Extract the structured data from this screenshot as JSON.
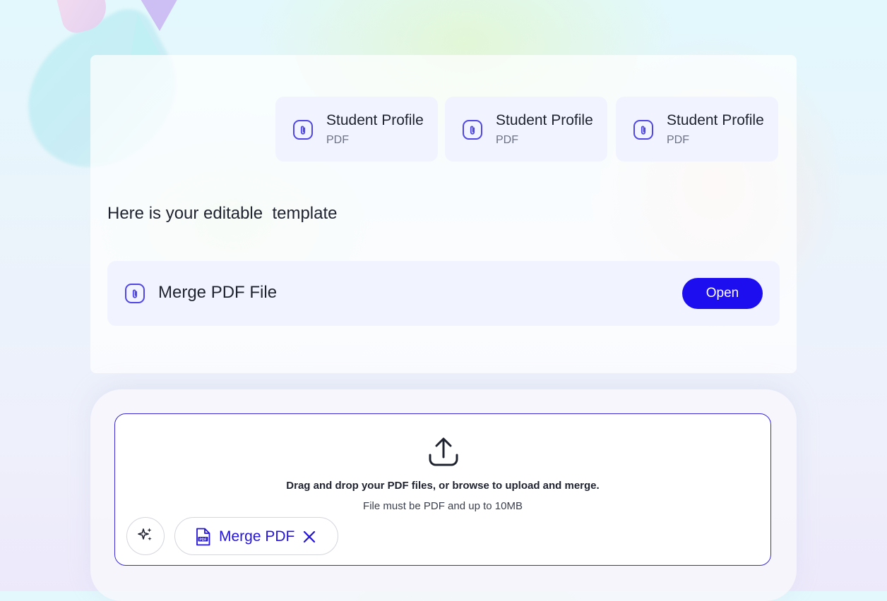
{
  "template_cards": [
    {
      "title": "Student Profile",
      "type": "PDF",
      "icon": "paperclip-icon"
    },
    {
      "title": "Student Profile",
      "type": "PDF",
      "icon": "paperclip-icon"
    },
    {
      "title": "Student Profile",
      "type": "PDF",
      "icon": "paperclip-icon"
    }
  ],
  "response": {
    "heading": "Here is your editable  template",
    "file_name": "Merge PDF File",
    "open_label": "Open"
  },
  "composer": {
    "drop_title": "Drag and drop your PDF files, or browse to upload and merge.",
    "drop_hint": "File must be PDF and up to 10MB",
    "upload_icon": "upload-icon",
    "magic_icon": "sparkles-icon",
    "tool_chip": {
      "label": "Merge PDF",
      "icon": "pdf-file-icon",
      "close_icon": "close-icon"
    }
  },
  "colors": {
    "accent": "#1d0ef0",
    "icon_purple": "#4f46e5",
    "chip_text": "#2414d8",
    "dropzone_border": "#3a2ad6"
  }
}
